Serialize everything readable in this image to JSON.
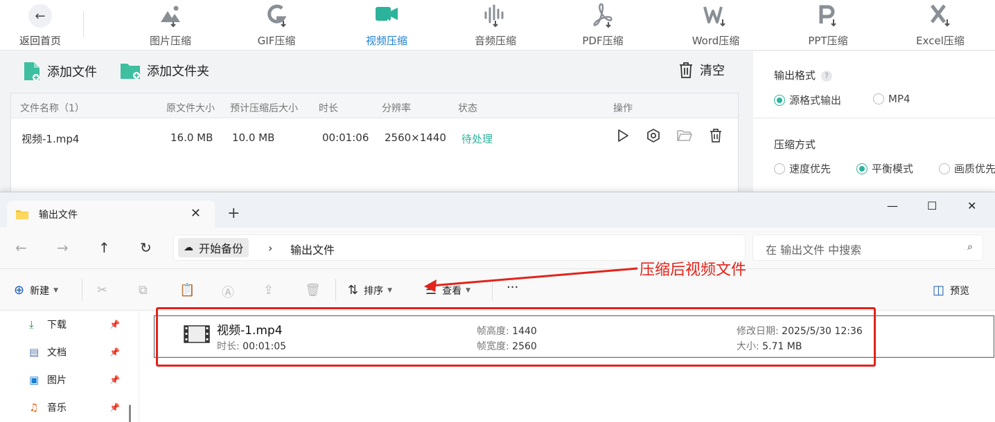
{
  "topbar": {
    "back_label": "返回首页",
    "tools": [
      {
        "label": "图片压缩",
        "icon": "image-compress-icon"
      },
      {
        "label": "GIF压缩",
        "icon": "gif-compress-icon"
      },
      {
        "label": "视频压缩",
        "icon": "video-compress-icon",
        "active": true
      },
      {
        "label": "音频压缩",
        "icon": "audio-compress-icon"
      },
      {
        "label": "PDF压缩",
        "icon": "pdf-compress-icon"
      },
      {
        "label": "Word压缩",
        "icon": "word-compress-icon"
      },
      {
        "label": "PPT压缩",
        "icon": "ppt-compress-icon"
      },
      {
        "label": "Excel压缩",
        "icon": "excel-compress-icon"
      }
    ]
  },
  "actions": {
    "add_file": "添加文件",
    "add_folder": "添加文件夹",
    "clear": "清空"
  },
  "table": {
    "headers": [
      "文件名称（1）",
      "原文件大小",
      "预计压缩后大小",
      "时长",
      "分辨率",
      "状态",
      "操作"
    ],
    "rows": [
      {
        "name": "视频-1.mp4",
        "orig_size": "16.0 MB",
        "est_size": "10.0 MB",
        "duration": "00:01:06",
        "resolution": "2560×1440",
        "status": "待处理"
      }
    ]
  },
  "settings": {
    "format_title": "输出格式",
    "format_help": "?",
    "format_options": [
      {
        "label": "源格式输出",
        "selected": true
      },
      {
        "label": "MP4",
        "selected": false
      }
    ],
    "mode_title": "压缩方式",
    "mode_options": [
      {
        "label": "速度优先",
        "selected": false
      },
      {
        "label": "平衡模式",
        "selected": true
      },
      {
        "label": "画质优先",
        "selected": false
      }
    ]
  },
  "explorer": {
    "tab_title": "输出文件",
    "path": [
      "开始备份",
      "输出文件"
    ],
    "search_placeholder": "在 输出文件 中搜索",
    "commands": {
      "new": "新建",
      "sort": "排序",
      "view": "查看",
      "more": "···",
      "preview": "预览"
    },
    "sidebar": [
      {
        "label": "下载",
        "icon": "download-icon"
      },
      {
        "label": "文档",
        "icon": "document-icon"
      },
      {
        "label": "图片",
        "icon": "picture-icon"
      },
      {
        "label": "音乐",
        "icon": "music-icon"
      }
    ],
    "file": {
      "name": "视频-1.mp4",
      "duration_key": "时长:",
      "duration": "00:01:05",
      "height_key": "帧高度:",
      "height": "1440",
      "width_key": "帧宽度:",
      "width": "2560",
      "modified_key": "修改日期:",
      "modified": "2025/5/30 12:36",
      "size_key": "大小:",
      "size": "5.71 MB"
    }
  },
  "annotation": {
    "text": "压缩后视频文件",
    "color": "#e2231a"
  },
  "colors": {
    "accent_blue": "#1a7fd6",
    "accent_green": "#2cb39b"
  }
}
